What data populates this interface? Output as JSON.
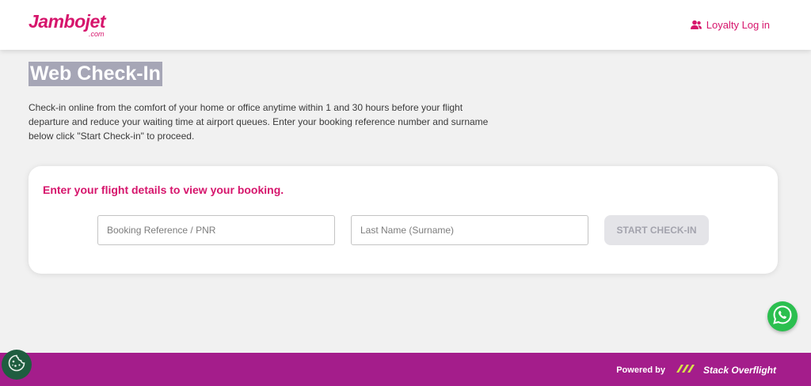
{
  "header": {
    "logo_text": "Jambojet",
    "logo_sub": ".com",
    "loyalty_label": "Loyalty Log in",
    "loyalty_icon": "users-icon"
  },
  "main": {
    "title": "Web Check-In",
    "intro": "Check-in online from the comfort of your home or office anytime within 1 and 30 hours before your flight departure and reduce your waiting time at airport queues. Enter your booking reference number and surname below click \"Start Check-in\" to proceed."
  },
  "form": {
    "heading": "Enter your flight details to view your booking.",
    "pnr_placeholder": "Booking Reference / PNR",
    "pnr_value": "",
    "surname_placeholder": "Last Name (Surname)",
    "surname_value": "",
    "start_label": "START CHECK-IN"
  },
  "widgets": {
    "whatsapp_icon": "whatsapp-icon",
    "cookie_icon": "cookie-icon"
  },
  "footer": {
    "powered_by": "Powered by",
    "brand": "Stack Overflight"
  },
  "colors": {
    "brand_pink": "#d6156c",
    "footer_purple": "#a41d8b",
    "whatsapp_green": "#2bbf4f",
    "cookie_green": "#1f5d40"
  }
}
